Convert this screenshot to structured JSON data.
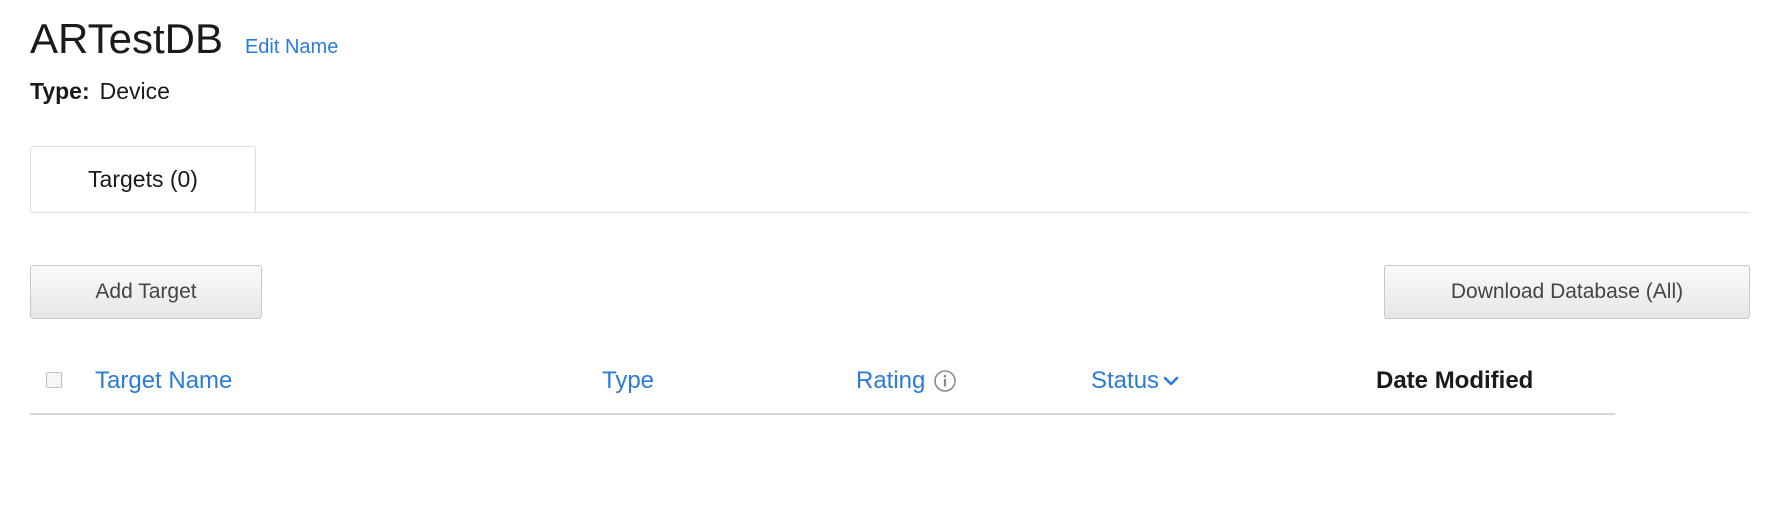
{
  "header": {
    "title": "ARTestDB",
    "edit_label": "Edit Name",
    "type_label": "Type:",
    "type_value": "Device"
  },
  "tabs": [
    {
      "label": "Targets (0)",
      "active": true
    }
  ],
  "toolbar": {
    "add_label": "Add Target",
    "download_label": "Download Database (All)"
  },
  "table": {
    "columns": [
      {
        "label": "Target Name",
        "sortable": true
      },
      {
        "label": "Type",
        "sortable": true
      },
      {
        "label": "Rating",
        "sortable": true,
        "icon": "info-icon"
      },
      {
        "label": "Status",
        "sortable": true,
        "icon": "chevron-down-icon"
      },
      {
        "label": "Date Modified",
        "sortable": false
      }
    ],
    "rows": []
  },
  "colors": {
    "link": "#2b7bd8",
    "text": "#1a1a1a",
    "border": "#dcdcdc"
  }
}
